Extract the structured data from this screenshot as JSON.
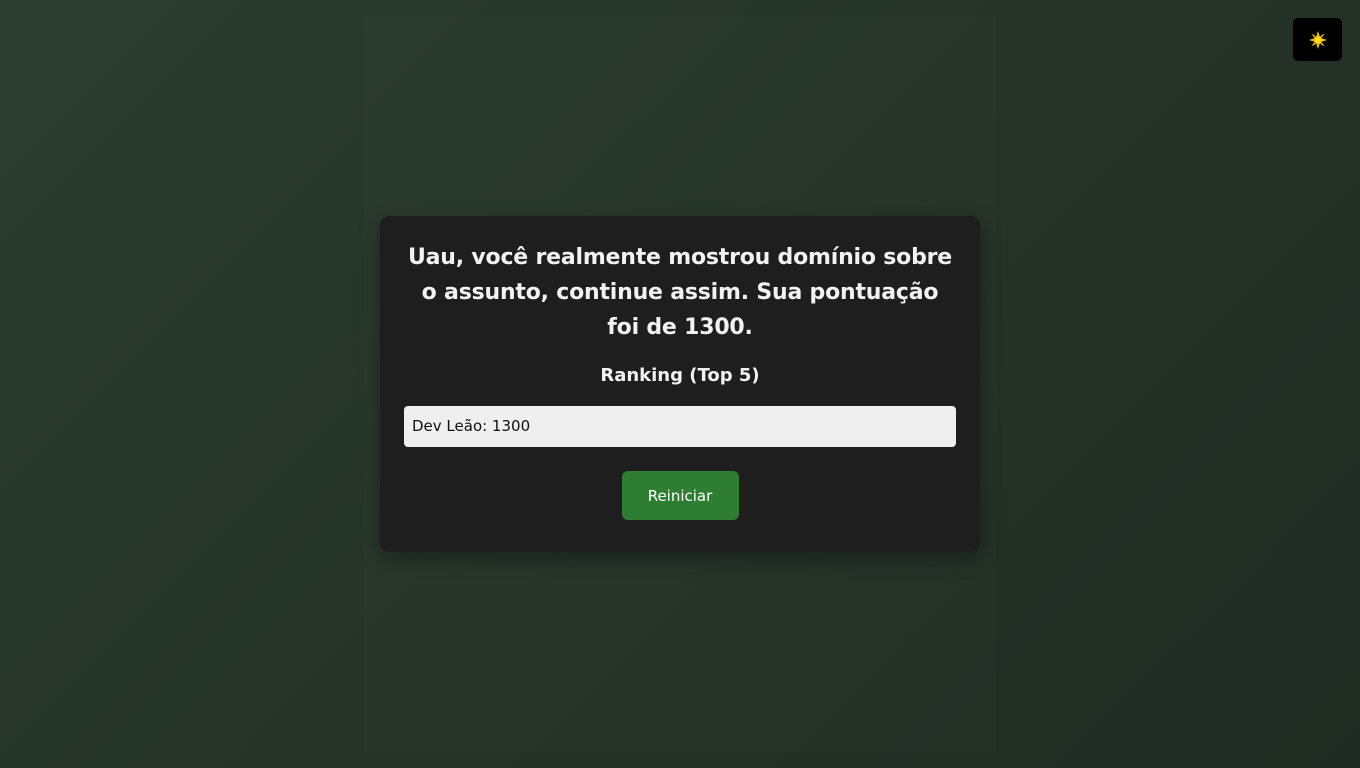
{
  "theme_toggle": {
    "icon": "sun-icon",
    "icon_color": "#f5c400"
  },
  "result": {
    "message": "Uau, você realmente mostrou domínio sobre o assunto, continue assim. Sua pontuação foi de 1300.",
    "ranking_title": "Ranking (Top 5)",
    "ranking": [
      {
        "entry": "Dev Leão: 1300"
      }
    ],
    "restart_label": "Reiniciar"
  },
  "colors": {
    "background": "#28362b",
    "card": "#1e1e1e",
    "accent": "#2e7d32",
    "ranking_item": "#efefef"
  }
}
